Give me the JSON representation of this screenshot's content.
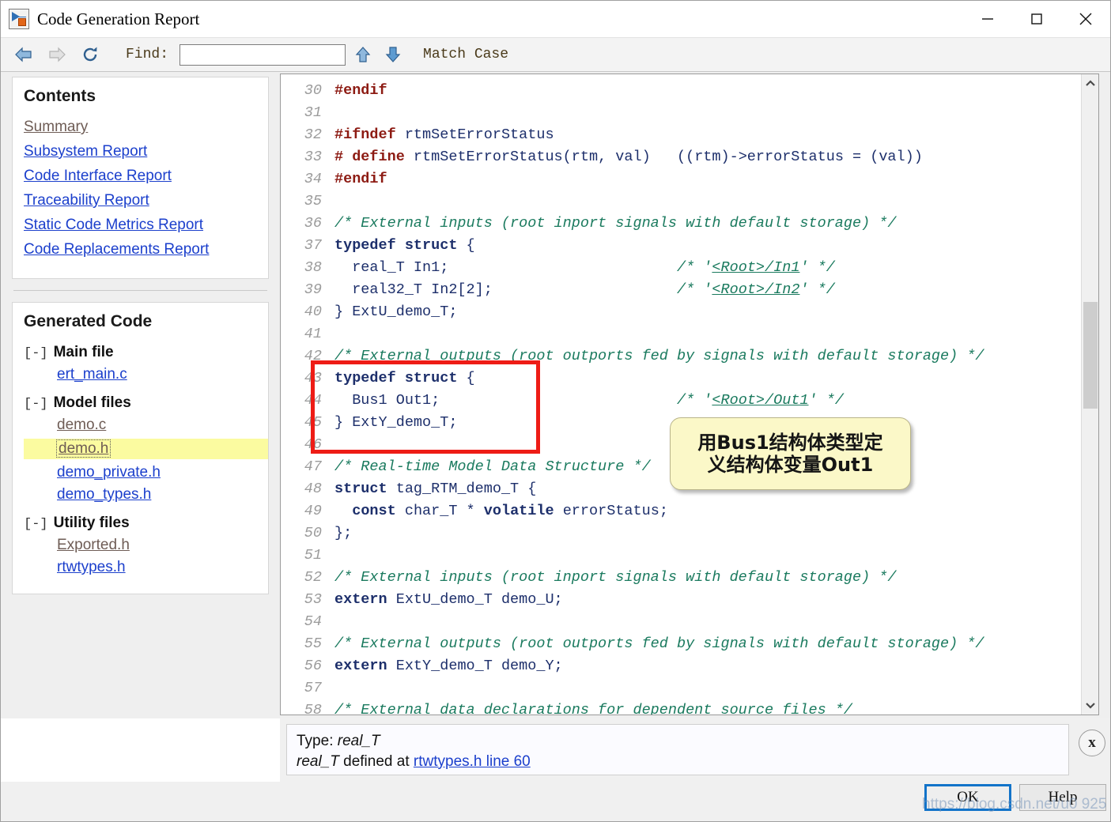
{
  "window": {
    "title": "Code Generation Report",
    "icon": "simulink-icon",
    "minimize_label": "minimize-icon",
    "maximize_label": "maximize-icon",
    "close_label": "close-icon"
  },
  "toolbar": {
    "back_icon": "back-arrow-icon",
    "forward_icon": "forward-arrow-icon",
    "refresh_icon": "refresh-icon",
    "find_label": "Find:",
    "find_value": "",
    "find_placeholder": "",
    "find_prev_icon": "arrow-up-icon",
    "find_next_icon": "arrow-down-icon",
    "match_case_label": "Match Case"
  },
  "sidebar": {
    "contents": {
      "title": "Contents",
      "links": [
        {
          "label": "Summary",
          "state": "visited"
        },
        {
          "label": "Subsystem Report",
          "state": "normal"
        },
        {
          "label": "Code Interface Report",
          "state": "normal"
        },
        {
          "label": "Traceability Report",
          "state": "normal"
        },
        {
          "label": "Static Code Metrics Report",
          "state": "normal"
        },
        {
          "label": "Code Replacements Report",
          "state": "normal"
        }
      ]
    },
    "generated_code": {
      "title": "Generated Code",
      "groups": [
        {
          "toggle": "[-]",
          "label": "Main file",
          "files": [
            {
              "label": "ert_main.c",
              "state": "normal",
              "selected": false
            }
          ]
        },
        {
          "toggle": "[-]",
          "label": "Model files",
          "files": [
            {
              "label": "demo.c",
              "state": "visited",
              "selected": false
            },
            {
              "label": "demo.h",
              "state": "visited",
              "selected": true
            },
            {
              "label": "demo_private.h",
              "state": "normal",
              "selected": false
            },
            {
              "label": "demo_types.h",
              "state": "normal",
              "selected": false
            }
          ]
        },
        {
          "toggle": "[-]",
          "label": "Utility files",
          "files": [
            {
              "label": "Exported.h",
              "state": "visited",
              "selected": false
            },
            {
              "label": "rtwtypes.h",
              "state": "normal",
              "selected": false
            }
          ]
        }
      ]
    }
  },
  "code": {
    "first_line": 30,
    "lines": [
      {
        "n": "30",
        "tokens": [
          {
            "t": "#endif",
            "c": "pp"
          }
        ]
      },
      {
        "n": "31",
        "tokens": []
      },
      {
        "n": "32",
        "tokens": [
          {
            "t": "#ifndef",
            "c": "pp"
          },
          {
            "t": " rtmSetErrorStatus",
            "c": "id"
          }
        ]
      },
      {
        "n": "33",
        "tokens": [
          {
            "t": "# define",
            "c": "pp"
          },
          {
            "t": " rtmSetErrorStatus(rtm, val)   ((rtm)->errorStatus = (val))",
            "c": "id"
          }
        ]
      },
      {
        "n": "34",
        "tokens": [
          {
            "t": "#endif",
            "c": "pp"
          }
        ]
      },
      {
        "n": "35",
        "tokens": []
      },
      {
        "n": "36",
        "tokens": [
          {
            "t": "/* External inputs (root inport signals with default storage) */",
            "c": "cm"
          }
        ]
      },
      {
        "n": "37",
        "tokens": [
          {
            "t": "typedef struct",
            "c": "kw"
          },
          {
            "t": " {",
            "c": "id"
          }
        ]
      },
      {
        "n": "38",
        "tokens": [
          {
            "t": "  real_T In1;                          ",
            "c": "id"
          },
          {
            "t": "/* '",
            "c": "cm"
          },
          {
            "t": "<Root>/In1",
            "c": "cml"
          },
          {
            "t": "' */",
            "c": "cm"
          }
        ]
      },
      {
        "n": "39",
        "tokens": [
          {
            "t": "  real32_T In2[2];                     ",
            "c": "id"
          },
          {
            "t": "/* '",
            "c": "cm"
          },
          {
            "t": "<Root>/In2",
            "c": "cml"
          },
          {
            "t": "' */",
            "c": "cm"
          }
        ]
      },
      {
        "n": "40",
        "tokens": [
          {
            "t": "} ExtU_demo_T;",
            "c": "id"
          }
        ]
      },
      {
        "n": "41",
        "tokens": []
      },
      {
        "n": "42",
        "tokens": [
          {
            "t": "/* External outputs (root outports fed by signals with default storage) */",
            "c": "cm"
          }
        ]
      },
      {
        "n": "43",
        "tokens": [
          {
            "t": "typedef struct",
            "c": "kw"
          },
          {
            "t": " {",
            "c": "id"
          }
        ]
      },
      {
        "n": "44",
        "tokens": [
          {
            "t": "  Bus1 Out1;                           ",
            "c": "id"
          },
          {
            "t": "/* '",
            "c": "cm"
          },
          {
            "t": "<Root>/Out1",
            "c": "cml"
          },
          {
            "t": "' */",
            "c": "cm"
          }
        ]
      },
      {
        "n": "45",
        "tokens": [
          {
            "t": "} ExtY_demo_T;",
            "c": "id"
          }
        ]
      },
      {
        "n": "46",
        "tokens": []
      },
      {
        "n": "47",
        "tokens": [
          {
            "t": "/* Real-time Model Data Structure */",
            "c": "cm"
          }
        ]
      },
      {
        "n": "48",
        "tokens": [
          {
            "t": "struct",
            "c": "kw"
          },
          {
            "t": " tag_RTM_demo_T {",
            "c": "id"
          }
        ]
      },
      {
        "n": "49",
        "tokens": [
          {
            "t": "  ",
            "c": "id"
          },
          {
            "t": "const",
            "c": "kw"
          },
          {
            "t": " char_T * ",
            "c": "id"
          },
          {
            "t": "volatile",
            "c": "kw"
          },
          {
            "t": " errorStatus;",
            "c": "id"
          }
        ]
      },
      {
        "n": "50",
        "tokens": [
          {
            "t": "};",
            "c": "id"
          }
        ]
      },
      {
        "n": "51",
        "tokens": []
      },
      {
        "n": "52",
        "tokens": [
          {
            "t": "/* External inputs (root inport signals with default storage) */",
            "c": "cm"
          }
        ]
      },
      {
        "n": "53",
        "tokens": [
          {
            "t": "extern",
            "c": "kw"
          },
          {
            "t": " ExtU_demo_T demo_U;",
            "c": "id"
          }
        ]
      },
      {
        "n": "54",
        "tokens": []
      },
      {
        "n": "55",
        "tokens": [
          {
            "t": "/* External outputs (root outports fed by signals with default storage) */",
            "c": "cm"
          }
        ]
      },
      {
        "n": "56",
        "tokens": [
          {
            "t": "extern",
            "c": "kw"
          },
          {
            "t": " ExtY_demo_T demo_Y;",
            "c": "id"
          }
        ]
      },
      {
        "n": "57",
        "tokens": []
      },
      {
        "n": "58",
        "tokens": [
          {
            "t": "/* External data declarations for dependent source files */",
            "c": "cm"
          }
        ]
      }
    ]
  },
  "annotations": {
    "red_box": {
      "highlights_lines": "43-46",
      "color": "#ee1c16"
    },
    "callout": {
      "line1": "用Bus1结构体类型定",
      "line2": "义结构体变量Out1",
      "bg_color": "#fbf8c8"
    }
  },
  "info_panel": {
    "line1_prefix": "Type: ",
    "line1_value": "real_T",
    "line2_type": "real_T",
    "line2_middle": " defined at ",
    "line2_link": "rtwtypes.h line 60",
    "close_label": "x"
  },
  "footer": {
    "ok_label": "OK",
    "help_label": "Help",
    "accent_color": "#1273c9"
  },
  "watermark": {
    "text": "https://blog.csdn.net/u0          925"
  },
  "scrollbar": {
    "up_icon": "chevron-up-icon",
    "down_icon": "chevron-down-icon",
    "thumb": "scrollbar-thumb"
  }
}
